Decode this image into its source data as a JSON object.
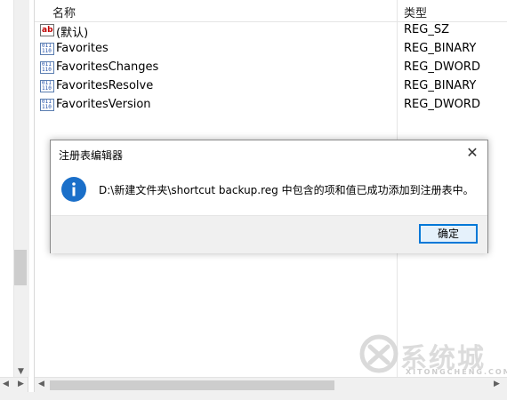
{
  "list": {
    "columns": {
      "name": "名称",
      "type": "类型"
    },
    "rows": [
      {
        "name": "(默认)",
        "type": "REG_SZ",
        "icon": "string-value-icon"
      },
      {
        "name": "Favorites",
        "type": "REG_BINARY",
        "icon": "binary-value-icon"
      },
      {
        "name": "FavoritesChanges",
        "type": "REG_DWORD",
        "icon": "binary-value-icon"
      },
      {
        "name": "FavoritesResolve",
        "type": "REG_BINARY",
        "icon": "binary-value-icon"
      },
      {
        "name": "FavoritesVersion",
        "type": "REG_DWORD",
        "icon": "binary-value-icon"
      }
    ]
  },
  "dialog": {
    "title": "注册表编辑器",
    "message": "D:\\新建文件夹\\shortcut backup.reg 中包含的项和值已成功添加到注册表中。",
    "ok_label": "确定",
    "close_glyph": "✕"
  },
  "watermark": {
    "text": "系统城",
    "subtext": "XITONGCHENG.COM"
  },
  "colors": {
    "accent": "#0078d7",
    "info_icon": "#1a6fc9"
  }
}
